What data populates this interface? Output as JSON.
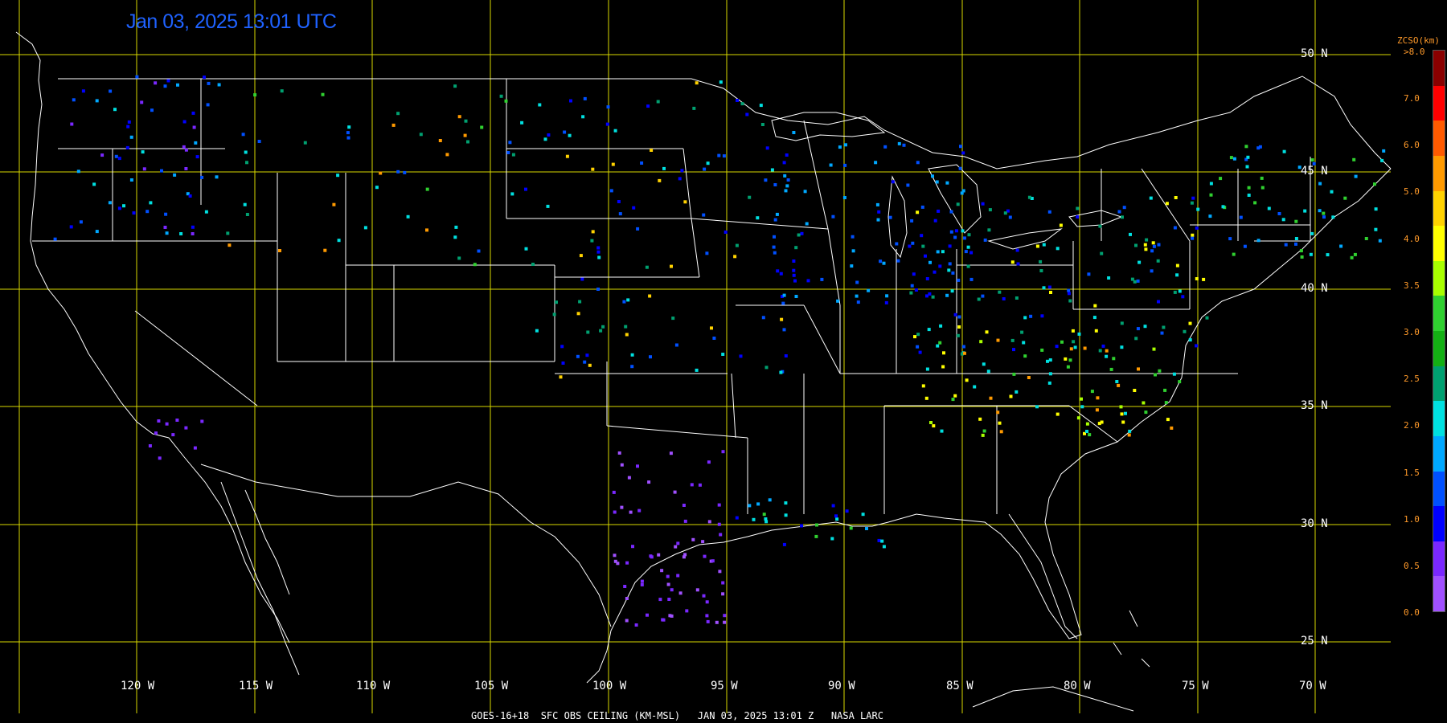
{
  "timestamp": "Jan 03, 2025 13:01 UTC",
  "latitude_labels": [
    "50 N",
    "45 N",
    "40 N",
    "35 N",
    "30 N",
    "25 N"
  ],
  "longitude_labels": [
    "120 W",
    "115 W",
    "110 W",
    "105 W",
    "100 W",
    "95 W",
    "90 W",
    "85 W",
    "80 W",
    "75 W",
    "70 W"
  ],
  "footer": "GOES-16+18  SFC OBS CEILING (KM-MSL)   JAN 03, 2025 13:01 Z   NASA LARC",
  "legend": {
    "title": "ZCSO(km)",
    "top_label": ">8.0",
    "ticks": [
      "7.0",
      "6.0",
      "5.0",
      "4.0",
      "3.5",
      "3.0",
      "2.5",
      "2.0",
      "1.5",
      "1.0",
      "0.5",
      "0.0"
    ],
    "colors": [
      "#8a0000",
      "#ff0000",
      "#ff5a00",
      "#ff9a00",
      "#ffd200",
      "#ffff00",
      "#a8ff00",
      "#30d030",
      "#14b014",
      "#00a070",
      "#00e0e0",
      "#00a8ff",
      "#0050ff",
      "#0000ff",
      "#7a28ff",
      "#a050ff"
    ]
  },
  "colors": {
    "grid": "#d8d800",
    "boundaries": "#ffffff",
    "timestamp": "#1f62ff"
  }
}
